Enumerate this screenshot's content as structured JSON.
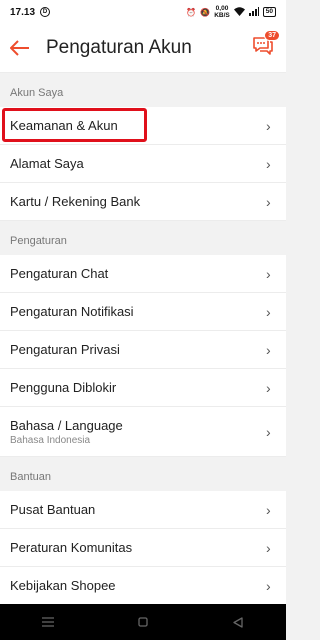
{
  "status": {
    "time": "17.13",
    "net_speed": "0,00",
    "net_unit": "KB/S",
    "battery": "50"
  },
  "header": {
    "title": "Pengaturan Akun",
    "chat_badge": "37"
  },
  "sections": {
    "akun": {
      "title": "Akun Saya",
      "items": [
        {
          "label": "Keamanan & Akun"
        },
        {
          "label": "Alamat Saya"
        },
        {
          "label": "Kartu / Rekening Bank"
        }
      ]
    },
    "pengaturan": {
      "title": "Pengaturan",
      "items": [
        {
          "label": "Pengaturan Chat"
        },
        {
          "label": "Pengaturan Notifikasi"
        },
        {
          "label": "Pengaturan Privasi"
        },
        {
          "label": "Pengguna Diblokir"
        },
        {
          "label": "Bahasa / Language",
          "sub": "Bahasa Indonesia"
        }
      ]
    },
    "bantuan": {
      "title": "Bantuan",
      "items": [
        {
          "label": "Pusat Bantuan"
        },
        {
          "label": "Peraturan Komunitas"
        },
        {
          "label": "Kebijakan Shopee"
        }
      ]
    }
  },
  "colors": {
    "accent": "#ee4d2d",
    "highlight": "#e0101b"
  }
}
